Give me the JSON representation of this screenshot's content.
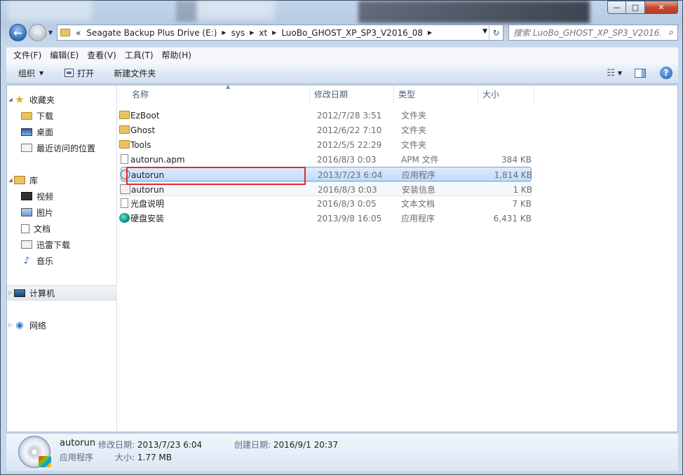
{
  "window": {
    "minimize_glyph": "—",
    "maximize_glyph": "□",
    "close_glyph": "✕"
  },
  "nav": {
    "back_glyph": "←",
    "forward_glyph": "→",
    "breadcrumb_overflow": "«",
    "breadcrumbs": [
      "Seagate Backup Plus Drive (E:)",
      "sys",
      "xt",
      "LuoBo_GHOST_XP_SP3_V2016_08"
    ],
    "search_placeholder": "搜索 LuoBo_GHOST_XP_SP3_V2016..."
  },
  "menu": [
    "文件(F)",
    "编辑(E)",
    "查看(V)",
    "工具(T)",
    "帮助(H)"
  ],
  "toolbar": {
    "organize": "组织",
    "open": "打开",
    "new_folder": "新建文件夹"
  },
  "sidebar": {
    "favorites": "收藏夹",
    "downloads": "下载",
    "desktop": "桌面",
    "recent": "最近访问的位置",
    "libraries": "库",
    "videos": "视频",
    "pictures": "图片",
    "documents": "文档",
    "xunlei": "迅雷下载",
    "music": "音乐",
    "computer": "计算机",
    "network": "网络"
  },
  "columns": {
    "name": "名称",
    "date": "修改日期",
    "type": "类型",
    "size": "大小"
  },
  "files": [
    {
      "name": "EzBoot",
      "date": "2012/7/28 3:51",
      "type": "文件夹",
      "size": "",
      "icon": "folder-icon"
    },
    {
      "name": "Ghost",
      "date": "2012/6/22 7:10",
      "type": "文件夹",
      "size": "",
      "icon": "folder-icon"
    },
    {
      "name": "Tools",
      "date": "2012/5/5 22:29",
      "type": "文件夹",
      "size": "",
      "icon": "folder-icon"
    },
    {
      "name": "autorun.apm",
      "date": "2016/8/3 0:03",
      "type": "APM 文件",
      "size": "384 KB",
      "icon": "file-icon"
    },
    {
      "name": "autorun",
      "date": "2013/7/23 6:04",
      "type": "应用程序",
      "size": "1,814 KB",
      "icon": "disc-app-icon"
    },
    {
      "name": "autorun",
      "date": "2016/8/3 0:03",
      "type": "安装信息",
      "size": "1 KB",
      "icon": "setup-info-icon"
    },
    {
      "name": "光盘说明",
      "date": "2016/8/3 0:05",
      "type": "文本文档",
      "size": "7 KB",
      "icon": "text-file-icon"
    },
    {
      "name": "硬盘安装",
      "date": "2013/9/8 16:05",
      "type": "应用程序",
      "size": "6,431 KB",
      "icon": "hdd-install-icon"
    }
  ],
  "details": {
    "name": "autorun",
    "type": "应用程序",
    "modified_label": "修改日期:",
    "modified_value": "2013/7/23 6:04",
    "created_label": "创建日期:",
    "created_value": "2016/9/1 20:37",
    "size_label": "大小:",
    "size_value": "1.77 MB"
  },
  "colors": {
    "selection": "#c1dcfc",
    "highlight_box": "#e12b2b"
  }
}
